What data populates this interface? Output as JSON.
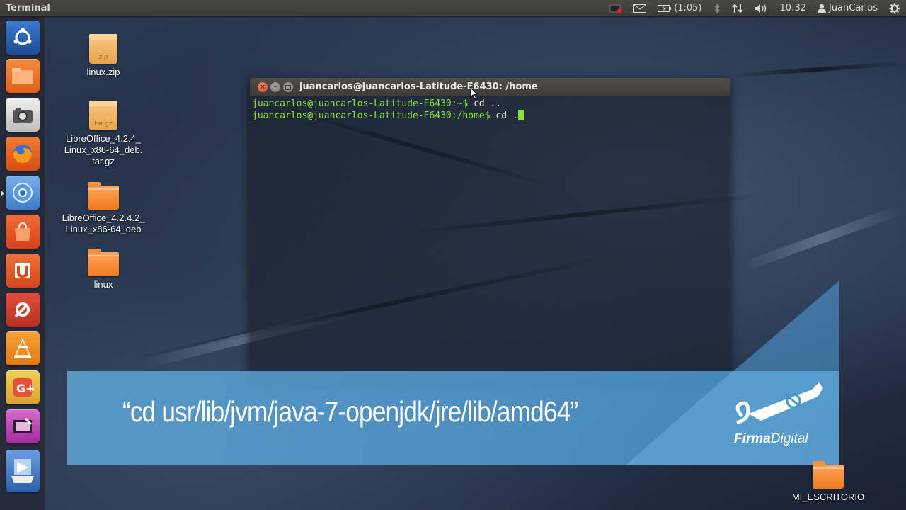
{
  "top_panel": {
    "app_title": "Terminal",
    "battery_time": "(1:05)",
    "clock": "10:32",
    "user": "JuanCarlos"
  },
  "launcher": {
    "items": [
      {
        "name": "dash-home",
        "color": "#2b5fa8"
      },
      {
        "name": "files",
        "color": "#ee6a1e"
      },
      {
        "name": "screenshot",
        "color": "#d9d9d9"
      },
      {
        "name": "firefox",
        "color": "#e66000"
      },
      {
        "name": "chromium",
        "color": "#5f93d6"
      },
      {
        "name": "software-center",
        "color": "#e2511f"
      },
      {
        "name": "ubuntu-one",
        "color": "#dd4814"
      },
      {
        "name": "system-settings",
        "color": "#c83d2a"
      },
      {
        "name": "vlc",
        "color": "#ef8b1f"
      },
      {
        "name": "google-plus",
        "color": "#e3b33a"
      },
      {
        "name": "video-editor",
        "color": "#c33fb5"
      },
      {
        "name": "scanner",
        "color": "#3d6fb8"
      }
    ]
  },
  "desktop_icons": [
    {
      "label": "linux.zip",
      "type": "zip",
      "tag": "zip"
    },
    {
      "label": "LibreOffice_4.2.4_\nLinux_x86-64_deb.\ntar.gz",
      "type": "archive",
      "tag": "tar.gz"
    },
    {
      "label": "LibreOffice_4.2.4.2_\nLinux_x86-64_deb",
      "type": "folder"
    },
    {
      "label": "linux",
      "type": "folder"
    },
    {
      "label": "MI_ESCRITORIO",
      "type": "folder"
    }
  ],
  "terminal": {
    "title": "juancarlos@juancarlos-Latitude-E6430: /home",
    "lines": [
      {
        "prompt": "juancarlos@juancarlos-Latitude-E6430:~$",
        "command": " cd .."
      },
      {
        "prompt": "juancarlos@juancarlos-Latitude-E6430:/home$",
        "command": " cd ."
      }
    ]
  },
  "caption": {
    "text": "“cd usr/lib/jvm/java-7-openjdk/jre/lib/amd64”",
    "brand_bold": "Firma",
    "brand_rest": "Digital"
  }
}
